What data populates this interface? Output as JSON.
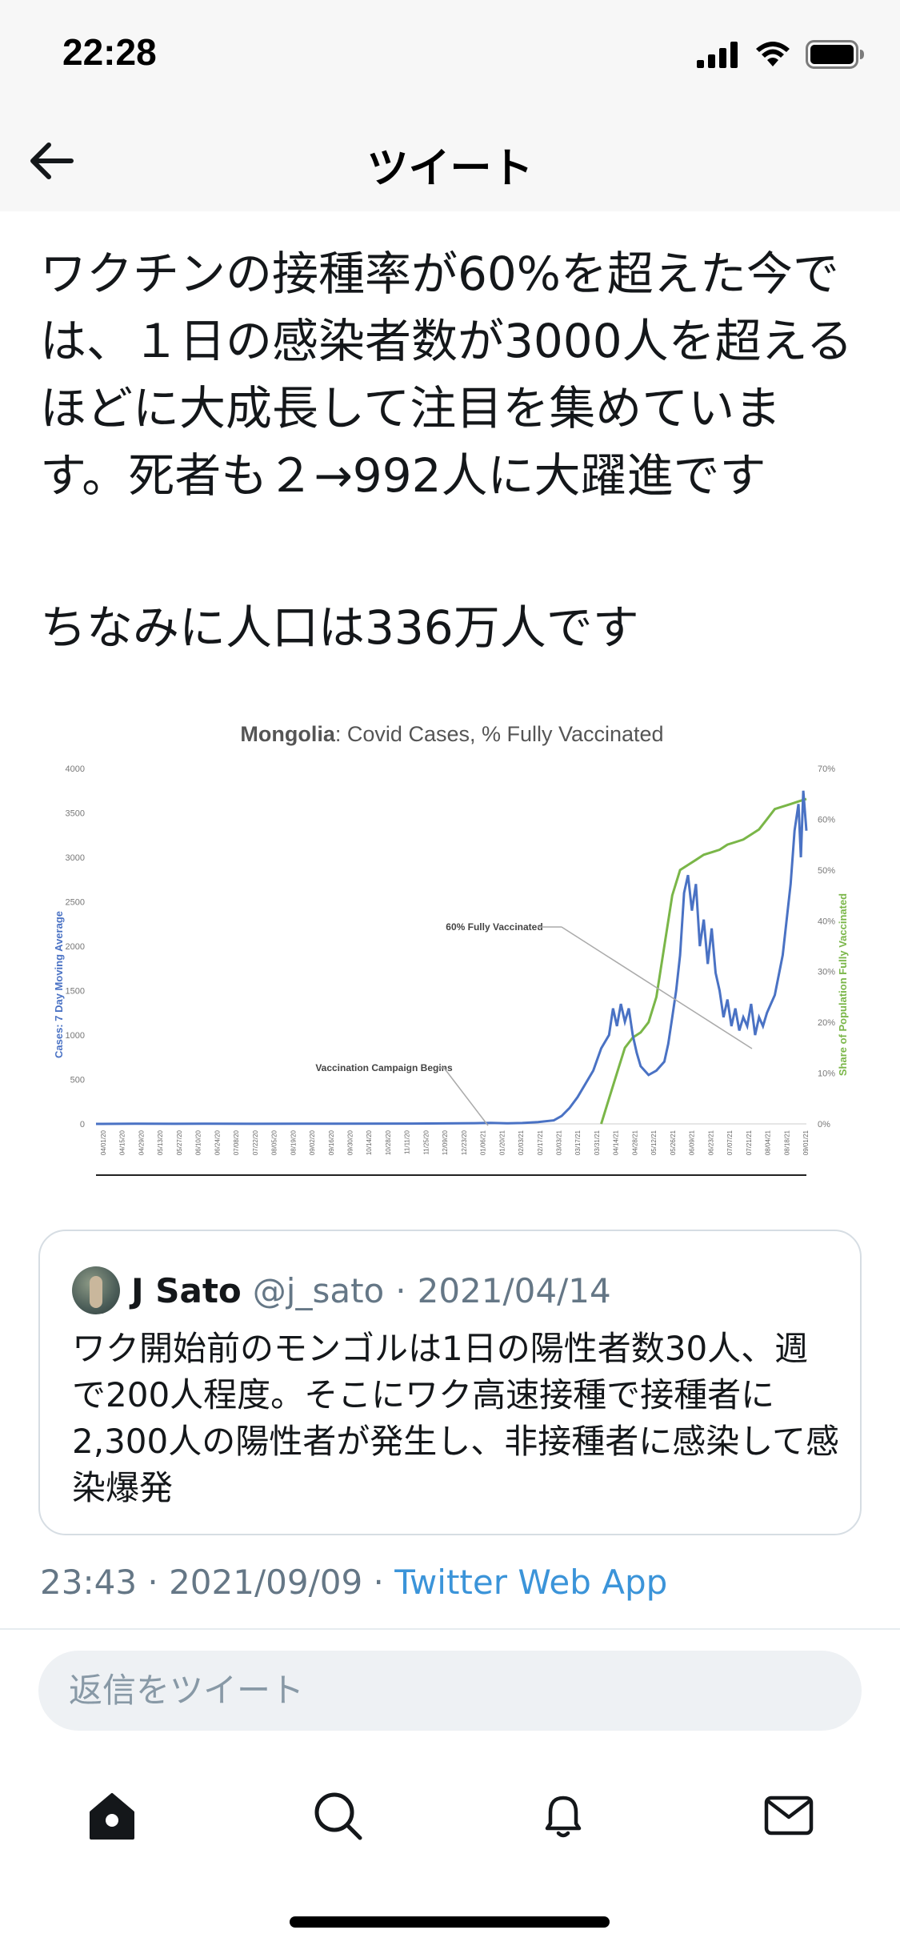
{
  "status": {
    "time": "22:28"
  },
  "nav": {
    "title": "ツイート"
  },
  "tweet": {
    "text": "ワクチンの接種率が60%を超えた今では、１日の感染者数が3000人を超えるほどに大成長して注目を集めています。死者も２→992人に大躍進です",
    "text2": "ちなみに人口は336万人です",
    "timestamp": "23:43 · 2021/09/09 · ",
    "source": "Twitter Web App"
  },
  "quote": {
    "name": "J Sato",
    "handle": "@j_sato",
    "separator": "·",
    "date": "2021/04/14",
    "text": "ワク開始前のモンゴルは1日の陽性者数30人、週で200人程度。そこにワク高速接種で接種者に2,300人の陽性者が発生し、非接種者に感染して感染爆発"
  },
  "reply": {
    "placeholder": "返信をツイート"
  },
  "tabs": [
    {
      "icon": "home-icon"
    },
    {
      "icon": "search-icon"
    },
    {
      "icon": "bell-icon"
    },
    {
      "icon": "mail-icon"
    }
  ],
  "colors": {
    "cases": "#4a72c4",
    "vaccinated": "#7ab648",
    "link": "#3b94d9"
  },
  "chart_data": {
    "type": "line",
    "title_bold": "Mongolia",
    "title_rest": ": Covid Cases, % Fully Vaccinated",
    "ylabel_left": "Cases: 7 Day Moving Average",
    "ylabel_right": "Share of Population Fully Vaccinated",
    "ylim_left": [
      0,
      4000
    ],
    "ylim_right": [
      0,
      70
    ],
    "y_ticks_left": [
      "0",
      "500",
      "1000",
      "1500",
      "2000",
      "2500",
      "3000",
      "3500",
      "4000"
    ],
    "y_ticks_right": [
      "0%",
      "10%",
      "20%",
      "30%",
      "40%",
      "50%",
      "60%",
      "70%"
    ],
    "x_ticks": [
      "04/01/20",
      "04/15/20",
      "04/29/20",
      "05/13/20",
      "05/27/20",
      "06/10/20",
      "06/24/20",
      "07/08/20",
      "07/22/20",
      "08/05/20",
      "08/19/20",
      "09/02/20",
      "09/16/20",
      "09/30/20",
      "10/14/20",
      "10/28/20",
      "11/11/20",
      "11/25/20",
      "12/09/20",
      "12/23/20",
      "01/06/21",
      "01/20/21",
      "02/03/21",
      "02/17/21",
      "03/03/21",
      "03/17/21",
      "03/31/21",
      "04/14/21",
      "04/28/21",
      "05/12/21",
      "05/26/21",
      "06/09/21",
      "06/23/21",
      "07/07/21",
      "07/21/21",
      "08/04/21",
      "08/18/21",
      "09/01/21"
    ],
    "annotations": [
      {
        "text": "60% Fully Vaccinated"
      },
      {
        "text": "Vaccination Campaign Begins"
      }
    ],
    "series": [
      {
        "name": "Cases",
        "axis": "left",
        "points": [
          [
            0,
            0
          ],
          [
            5,
            2
          ],
          [
            10,
            1
          ],
          [
            14,
            2
          ],
          [
            20,
            1
          ],
          [
            30,
            3
          ],
          [
            40,
            4
          ],
          [
            48,
            8
          ],
          [
            50,
            12
          ],
          [
            52,
            6
          ],
          [
            54,
            10
          ],
          [
            56,
            20
          ],
          [
            58,
            40
          ],
          [
            59,
            90
          ],
          [
            60,
            180
          ],
          [
            61,
            300
          ],
          [
            62,
            450
          ],
          [
            63,
            600
          ],
          [
            64,
            850
          ],
          [
            65,
            1000
          ],
          [
            65.5,
            1300
          ],
          [
            66,
            1100
          ],
          [
            66.5,
            1350
          ],
          [
            67,
            1150
          ],
          [
            67.5,
            1300
          ],
          [
            68,
            1000
          ],
          [
            68.5,
            800
          ],
          [
            69,
            650
          ],
          [
            70,
            550
          ],
          [
            71,
            600
          ],
          [
            72,
            700
          ],
          [
            72.5,
            900
          ],
          [
            73,
            1200
          ],
          [
            73.5,
            1500
          ],
          [
            74,
            1900
          ],
          [
            74.5,
            2600
          ],
          [
            75,
            2800
          ],
          [
            75.5,
            2400
          ],
          [
            76,
            2700
          ],
          [
            76.5,
            2000
          ],
          [
            77,
            2300
          ],
          [
            77.5,
            1800
          ],
          [
            78,
            2200
          ],
          [
            78.5,
            1700
          ],
          [
            79,
            1500
          ],
          [
            79.5,
            1200
          ],
          [
            80,
            1400
          ],
          [
            80.5,
            1100
          ],
          [
            81,
            1300
          ],
          [
            81.5,
            1050
          ],
          [
            82,
            1200
          ],
          [
            82.5,
            1100
          ],
          [
            83,
            1350
          ],
          [
            83.5,
            1000
          ],
          [
            84,
            1200
          ],
          [
            84.5,
            1100
          ],
          [
            85,
            1250
          ],
          [
            85.5,
            1350
          ],
          [
            86,
            1450
          ],
          [
            87,
            1900
          ],
          [
            88,
            2700
          ],
          [
            88.5,
            3300
          ],
          [
            89,
            3600
          ],
          [
            89.3,
            3000
          ],
          [
            89.6,
            3750
          ],
          [
            90,
            3300
          ]
        ]
      },
      {
        "name": "Fully Vaccinated",
        "axis": "right",
        "points": [
          [
            64,
            0
          ],
          [
            65,
            5
          ],
          [
            66,
            10
          ],
          [
            67,
            15
          ],
          [
            68,
            17
          ],
          [
            69,
            18
          ],
          [
            70,
            20
          ],
          [
            71,
            25
          ],
          [
            72,
            35
          ],
          [
            73,
            45
          ],
          [
            74,
            50
          ],
          [
            75,
            51
          ],
          [
            76,
            52
          ],
          [
            77,
            53
          ],
          [
            78,
            53.5
          ],
          [
            79,
            54
          ],
          [
            80,
            55
          ],
          [
            81,
            55.5
          ],
          [
            82,
            56
          ],
          [
            83,
            57
          ],
          [
            84,
            58
          ],
          [
            85,
            60
          ],
          [
            86,
            62
          ],
          [
            87,
            62.5
          ],
          [
            88,
            63
          ],
          [
            89,
            63.5
          ],
          [
            90,
            64
          ]
        ]
      }
    ],
    "x_range": [
      0,
      90
    ]
  }
}
